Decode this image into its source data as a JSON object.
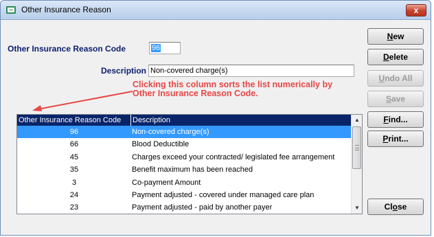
{
  "window": {
    "title": "Other Insurance Reason",
    "close_glyph": "x"
  },
  "form": {
    "code_label": "Other Insurance Reason Code",
    "code_value": "96",
    "description_label": "Description",
    "description_value": "Non-covered charge(s)"
  },
  "annotation": {
    "text": "Clicking this column sorts the list numerically by Other Insurance Reason Code.",
    "color": "#e84646"
  },
  "buttons": {
    "new": {
      "label_first": "N",
      "label_rest": "ew"
    },
    "delete": {
      "label_first": "D",
      "label_rest": "elete"
    },
    "undo_all": {
      "label_first": "U",
      "label_rest": "ndo All"
    },
    "save": {
      "label_first": "S",
      "label_rest": "ave"
    },
    "find": {
      "label_first": "F",
      "label_rest": "ind..."
    },
    "print": {
      "label_first": "P",
      "label_rest": "rint..."
    },
    "close": {
      "label_first": "Cl",
      "label_mid": "o",
      "label_rest": "se"
    }
  },
  "grid": {
    "columns": [
      "Other Insurance Reason Code",
      "Description"
    ],
    "rows": [
      {
        "code": "96",
        "description": "Non-covered charge(s)",
        "selected": true
      },
      {
        "code": "66",
        "description": "Blood Deductible",
        "selected": false
      },
      {
        "code": "45",
        "description": "Charges exceed your contracted/ legislated fee arrangement",
        "selected": false
      },
      {
        "code": "35",
        "description": "Benefit maximum has been reached",
        "selected": false
      },
      {
        "code": "3",
        "description": "Co-payment Amount",
        "selected": false
      },
      {
        "code": "24",
        "description": "Payment adjusted - covered under managed care plan",
        "selected": false
      },
      {
        "code": "23",
        "description": "Payment adjusted - paid by another payer",
        "selected": false
      }
    ],
    "header_color": "#0a246a",
    "selection_color": "#3399ff"
  }
}
